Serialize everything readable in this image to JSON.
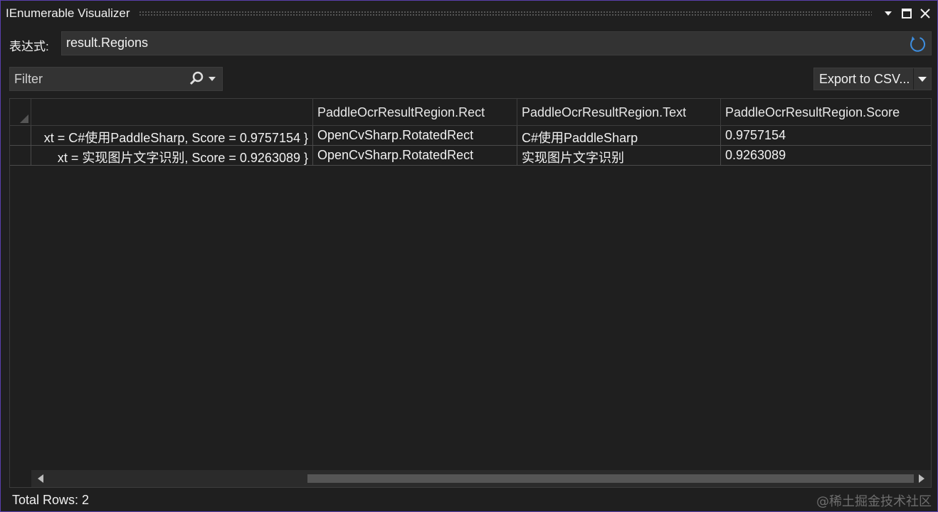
{
  "window": {
    "title": "IEnumerable Visualizer"
  },
  "expression": {
    "label": "表达式:",
    "value": "result.Regions"
  },
  "filter": {
    "placeholder": "Filter"
  },
  "export": {
    "label": "Export to CSV..."
  },
  "grid": {
    "columns": [
      "",
      "PaddleOcrResultRegion.Rect",
      "PaddleOcrResultRegion.Text",
      "PaddleOcrResultRegion.Score"
    ],
    "rows": [
      [
        "xt = C#使用PaddleSharp, Score = 0.9757154 }",
        "OpenCvSharp.RotatedRect",
        "C#使用PaddleSharp",
        "0.9757154"
      ],
      [
        "xt = 实现图片文字识别, Score = 0.9263089 }",
        "OpenCvSharp.RotatedRect",
        "实现图片文字识别",
        "0.9263089"
      ]
    ]
  },
  "status": {
    "total_rows": "Total Rows: 2"
  },
  "watermark": "@稀土掘金技术社区",
  "colors": {
    "background": "#1f1f1f",
    "border_accent": "#5a3fae",
    "input_bg": "#333333",
    "refresh_icon": "#3d8ee0"
  },
  "icons": [
    "dropdown-arrow-icon",
    "maximize-icon",
    "close-icon",
    "refresh-icon",
    "search-icon",
    "chevron-down-icon",
    "scroll-left-icon",
    "scroll-right-icon"
  ]
}
